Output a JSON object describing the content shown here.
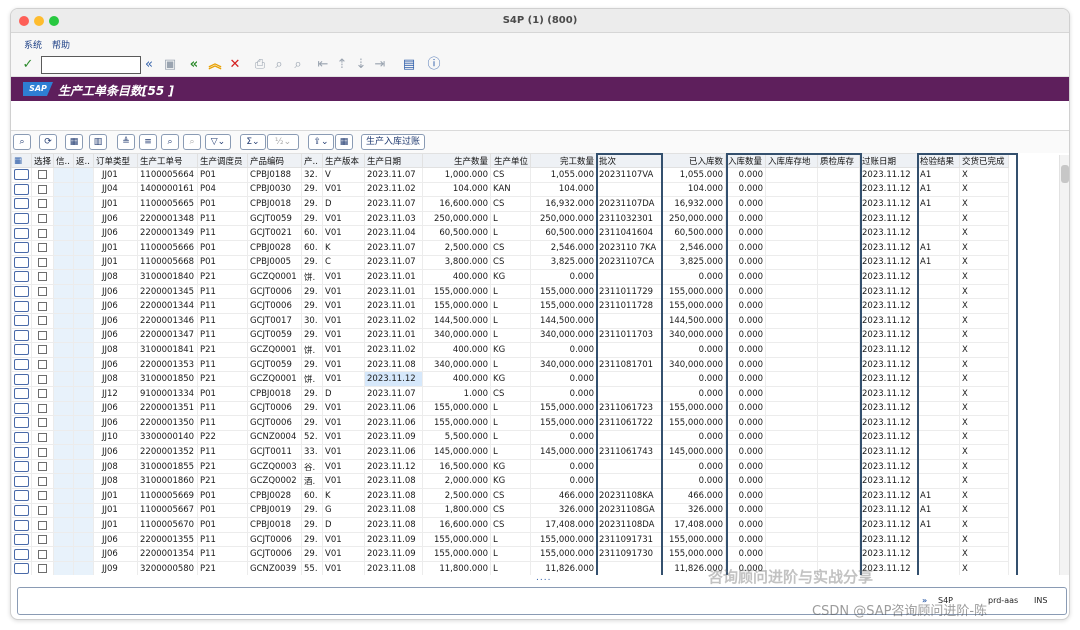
{
  "window": {
    "title": "S4P (1) (800)"
  },
  "menu": {
    "items": [
      "系统",
      "帮助"
    ]
  },
  "toolbar": {
    "command_value": ""
  },
  "header": {
    "title": "生产工单条目数[55 ]"
  },
  "alv": {
    "stock_in_button": "生产入库过账"
  },
  "columns": [
    "选择",
    "信..",
    "返..",
    "订单类型",
    "生产工单号",
    "生产调度员",
    "产品编码",
    "产..",
    "生产版本",
    "生产日期",
    "生产数量",
    "生产单位",
    "完工数量",
    "批次",
    "已入库数",
    "入库数量",
    "入库库存地",
    "质检库存",
    "过账日期",
    "检验结果",
    "交货已完成"
  ],
  "rows": [
    [
      "JJ01",
      "1100005664",
      "P01",
      "CPBJ0188",
      "32.",
      "V",
      "2023.11.07",
      "1,000.000",
      "CS",
      "1,055.000",
      "20231107VA",
      "1,055.000",
      "0.000",
      "",
      "",
      "2023.11.12",
      "A1",
      "X"
    ],
    [
      "JJ04",
      "1400000161",
      "P04",
      "CPBJ0030",
      "29.",
      "V01",
      "2023.11.02",
      "104.000",
      "KAN",
      "104.000",
      "",
      "104.000",
      "0.000",
      "",
      "",
      "2023.11.12",
      "A1",
      "X"
    ],
    [
      "JJ01",
      "1100005665",
      "P01",
      "CPBJ0018",
      "29.",
      "D",
      "2023.11.07",
      "16,600.000",
      "CS",
      "16,932.000",
      "20231107DA",
      "16,932.000",
      "0.000",
      "",
      "",
      "2023.11.12",
      "A1",
      "X"
    ],
    [
      "JJ06",
      "2200001348",
      "P11",
      "GCJT0059",
      "29.",
      "V01",
      "2023.11.03",
      "250,000.000",
      "L",
      "250,000.000",
      "2311032301",
      "250,000.000",
      "0.000",
      "",
      "",
      "2023.11.12",
      "",
      "X"
    ],
    [
      "JJ06",
      "2200001349",
      "P11",
      "GCJT0021",
      "60.",
      "V01",
      "2023.11.04",
      "60,500.000",
      "L",
      "60,500.000",
      "2311041604",
      "60,500.000",
      "0.000",
      "",
      "",
      "2023.11.12",
      "",
      "X"
    ],
    [
      "JJ01",
      "1100005666",
      "P01",
      "CPBJ0028",
      "60.",
      "K",
      "2023.11.07",
      "2,500.000",
      "CS",
      "2,546.000",
      "2023110 7KA",
      "2,546.000",
      "0.000",
      "",
      "",
      "2023.11.12",
      "A1",
      "X"
    ],
    [
      "JJ01",
      "1100005668",
      "P01",
      "CPBJ0005",
      "29.",
      "C",
      "2023.11.07",
      "3,800.000",
      "CS",
      "3,825.000",
      "20231107CA",
      "3,825.000",
      "0.000",
      "",
      "",
      "2023.11.12",
      "A1",
      "X"
    ],
    [
      "JJ08",
      "3100001840",
      "P21",
      "GCZQ0001",
      "饼.",
      "V01",
      "2023.11.01",
      "400.000",
      "KG",
      "0.000",
      "",
      "0.000",
      "0.000",
      "",
      "",
      "2023.11.12",
      "",
      "X"
    ],
    [
      "JJ06",
      "2200001345",
      "P11",
      "GCJT0006",
      "29.",
      "V01",
      "2023.11.01",
      "155,000.000",
      "L",
      "155,000.000",
      "2311011729",
      "155,000.000",
      "0.000",
      "",
      "",
      "2023.11.12",
      "",
      "X"
    ],
    [
      "JJ06",
      "2200001344",
      "P11",
      "GCJT0006",
      "29.",
      "V01",
      "2023.11.01",
      "155,000.000",
      "L",
      "155,000.000",
      "2311011728",
      "155,000.000",
      "0.000",
      "",
      "",
      "2023.11.12",
      "",
      "X"
    ],
    [
      "JJ06",
      "2200001346",
      "P11",
      "GCJT0017",
      "30.",
      "V01",
      "2023.11.02",
      "144,500.000",
      "L",
      "144,500.000",
      "",
      "144,500.000",
      "0.000",
      "",
      "",
      "2023.11.12",
      "",
      "X"
    ],
    [
      "JJ06",
      "2200001347",
      "P11",
      "GCJT0059",
      "29.",
      "V01",
      "2023.11.01",
      "340,000.000",
      "L",
      "340,000.000",
      "2311011703",
      "340,000.000",
      "0.000",
      "",
      "",
      "2023.11.12",
      "",
      "X"
    ],
    [
      "JJ08",
      "3100001841",
      "P21",
      "GCZQ0001",
      "饼.",
      "V01",
      "2023.11.02",
      "400.000",
      "KG",
      "0.000",
      "",
      "0.000",
      "0.000",
      "",
      "",
      "2023.11.12",
      "",
      "X"
    ],
    [
      "JJ06",
      "2200001353",
      "P11",
      "GCJT0059",
      "29.",
      "V01",
      "2023.11.08",
      "340,000.000",
      "L",
      "340,000.000",
      "2311081701",
      "340,000.000",
      "0.000",
      "",
      "",
      "2023.11.12",
      "",
      "X"
    ],
    [
      "JJ08",
      "3100001850",
      "P21",
      "GCZQ0001",
      "饼.",
      "V01",
      "2023.11.12",
      "400.000",
      "KG",
      "0.000",
      "",
      "0.000",
      "0.000",
      "",
      "",
      "2023.11.12",
      "",
      "X"
    ],
    [
      "JJ12",
      "9100001334",
      "P01",
      "CPBJ0018",
      "29.",
      "D",
      "2023.11.07",
      "1.000",
      "CS",
      "0.000",
      "",
      "0.000",
      "0.000",
      "",
      "",
      "2023.11.12",
      "",
      "X"
    ],
    [
      "JJ06",
      "2200001351",
      "P11",
      "GCJT0006",
      "29.",
      "V01",
      "2023.11.06",
      "155,000.000",
      "L",
      "155,000.000",
      "2311061723",
      "155,000.000",
      "0.000",
      "",
      "",
      "2023.11.12",
      "",
      "X"
    ],
    [
      "JJ06",
      "2200001350",
      "P11",
      "GCJT0006",
      "29.",
      "V01",
      "2023.11.06",
      "155,000.000",
      "L",
      "155,000.000",
      "2311061722",
      "155,000.000",
      "0.000",
      "",
      "",
      "2023.11.12",
      "",
      "X"
    ],
    [
      "JJ10",
      "3300000140",
      "P22",
      "GCNZ0004",
      "52.",
      "V01",
      "2023.11.09",
      "5,500.000",
      "L",
      "0.000",
      "",
      "0.000",
      "0.000",
      "",
      "",
      "2023.11.12",
      "",
      "X"
    ],
    [
      "JJ06",
      "2200001352",
      "P11",
      "GCJT0011",
      "33.",
      "V01",
      "2023.11.06",
      "145,000.000",
      "L",
      "145,000.000",
      "2311061743",
      "145,000.000",
      "0.000",
      "",
      "",
      "2023.11.12",
      "",
      "X"
    ],
    [
      "JJ08",
      "3100001855",
      "P21",
      "GCZQ0003",
      "谷.",
      "V01",
      "2023.11.12",
      "16,500.000",
      "KG",
      "0.000",
      "",
      "0.000",
      "0.000",
      "",
      "",
      "2023.11.12",
      "",
      "X"
    ],
    [
      "JJ08",
      "3100001860",
      "P21",
      "GCZQ0002",
      "酒.",
      "V01",
      "2023.11.08",
      "2,000.000",
      "KG",
      "0.000",
      "",
      "0.000",
      "0.000",
      "",
      "",
      "2023.11.12",
      "",
      "X"
    ],
    [
      "JJ01",
      "1100005669",
      "P01",
      "CPBJ0028",
      "60.",
      "K",
      "2023.11.08",
      "2,500.000",
      "CS",
      "466.000",
      "20231108KA",
      "466.000",
      "0.000",
      "",
      "",
      "2023.11.12",
      "A1",
      "X"
    ],
    [
      "JJ01",
      "1100005667",
      "P01",
      "CPBJ0019",
      "29.",
      "G",
      "2023.11.08",
      "1,800.000",
      "CS",
      "326.000",
      "20231108GA",
      "326.000",
      "0.000",
      "",
      "",
      "2023.11.12",
      "A1",
      "X"
    ],
    [
      "JJ01",
      "1100005670",
      "P01",
      "CPBJ0018",
      "29.",
      "D",
      "2023.11.08",
      "16,600.000",
      "CS",
      "17,408.000",
      "20231108DA",
      "17,408.000",
      "0.000",
      "",
      "",
      "2023.11.12",
      "A1",
      "X"
    ],
    [
      "JJ06",
      "2200001355",
      "P11",
      "GCJT0006",
      "29.",
      "V01",
      "2023.11.09",
      "155,000.000",
      "L",
      "155,000.000",
      "2311091731",
      "155,000.000",
      "0.000",
      "",
      "",
      "2023.11.12",
      "",
      "X"
    ],
    [
      "JJ06",
      "2200001354",
      "P11",
      "GCJT0006",
      "29.",
      "V01",
      "2023.11.09",
      "155,000.000",
      "L",
      "155,000.000",
      "2311091730",
      "155,000.000",
      "0.000",
      "",
      "",
      "2023.11.12",
      "",
      "X"
    ],
    [
      "JJ09",
      "3200000580",
      "P21",
      "GCNZ0039",
      "55.",
      "V01",
      "2023.11.08",
      "11,800.000",
      "L",
      "11,826.000",
      "",
      "11,826.000",
      "0.000",
      "",
      "",
      "2023.11.12",
      "",
      "X"
    ]
  ],
  "status": {
    "more": "....",
    "system": "S4P",
    "server": "prd-aas",
    "mode": "INS"
  },
  "watermark": {
    "line1": "咨询顾问进阶与实战分享",
    "line2": "CSDN @SAP咨询顾问进阶-陈"
  }
}
